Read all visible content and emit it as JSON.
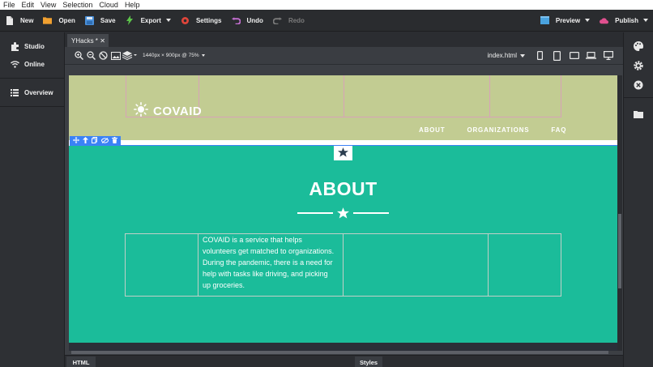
{
  "menubar": {
    "items": [
      "File",
      "Edit",
      "View",
      "Selection",
      "Cloud",
      "Help"
    ]
  },
  "toolbar": {
    "new_label": "New",
    "open_label": "Open",
    "save_label": "Save",
    "export_label": "Export",
    "settings_label": "Settings",
    "undo_label": "Undo",
    "redo_label": "Redo",
    "preview_label": "Preview",
    "publish_label": "Publish"
  },
  "sidebar": {
    "items": [
      {
        "label": "Studio",
        "icon": "puzzle-icon"
      },
      {
        "label": "Online",
        "icon": "wifi-icon"
      },
      {
        "label": "Overview",
        "icon": "list-icon"
      }
    ]
  },
  "document_tab": {
    "label": "YHacks *"
  },
  "canvas_toolbar": {
    "size_label": "1440px × 900px @ 75%",
    "file_label": "index.html"
  },
  "site": {
    "brand": "COVAID",
    "nav": [
      "ABOUT",
      "ORGANIZATIONS",
      "FAQ"
    ],
    "about_heading": "ABOUT",
    "about_text": "COVAID is a service that helps volunteers get matched to organizations. During the pandemic, there is a need for help with tasks like driving,  and picking up groceries."
  },
  "bottom_panel": {
    "html_tab": "HTML",
    "styles_tab": "Styles"
  },
  "colors": {
    "nav_bg": "#c2cc92",
    "section_bg": "#1bbc9a",
    "selection": "#3b82f6",
    "toolbar_bg": "#2a2c2f"
  }
}
